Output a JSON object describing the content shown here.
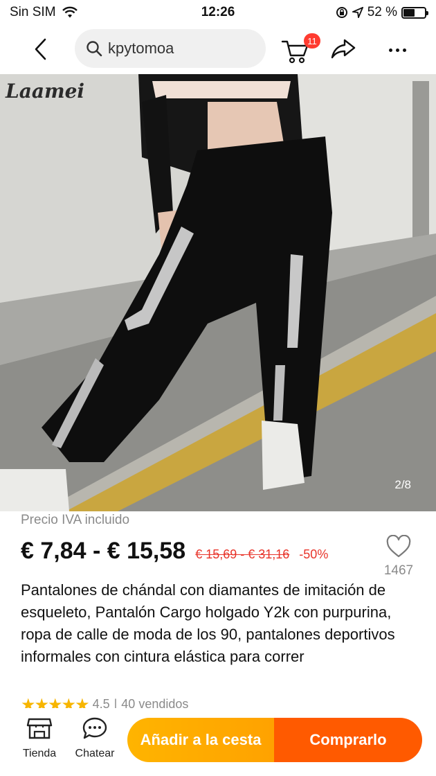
{
  "status_bar": {
    "carrier": "Sin SIM",
    "time": "12:26",
    "battery_percent": "52 %",
    "battery_level": 0.52
  },
  "nav": {
    "search_value": "kpytomoa",
    "cart_count": "11"
  },
  "product_image": {
    "brand": "Laamei",
    "counter": "2/8"
  },
  "product": {
    "vat_note": "Precio IVA incluido",
    "price": "€ 7,84 - € 15,58",
    "old_price": "€ 15,69 - € 31,16",
    "discount": "-50%",
    "wishlist_count": "1467",
    "title": "Pantalones de chándal con diamantes de imitación de esqueleto, Pantalón Cargo holgado Y2k con purpurina, ropa de calle de moda de los 90, pantalones deportivos informales con cintura elástica para correr",
    "rating": "4.5",
    "sold": "40 vendidos"
  },
  "bottom_bar": {
    "store_label": "Tienda",
    "chat_label": "Chatear",
    "add_to_cart_label": "Añadir a la cesta",
    "buy_label": "Comprarlo"
  },
  "colors": {
    "accent_orange": "#ff5a00",
    "cart_yellow": "#ffb400",
    "price_red": "#e8342a",
    "badge_red": "#ff3b30"
  },
  "icons": [
    "wifi-icon",
    "location-icon",
    "rotation-lock-icon",
    "battery-icon",
    "back-icon",
    "search-icon",
    "cart-icon",
    "share-icon",
    "more-icon",
    "heart-icon",
    "store-icon",
    "chat-icon",
    "star-icon"
  ]
}
